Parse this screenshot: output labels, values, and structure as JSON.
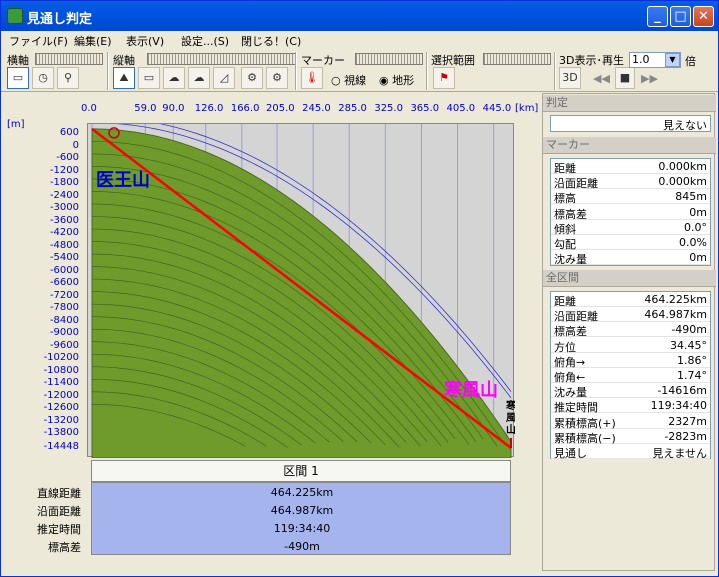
{
  "window": {
    "title": "見通し判定"
  },
  "menu": [
    "ファイル(F)",
    "編集(E)",
    "表示(V)",
    "設定...(S)",
    "閉じる！(C)"
  ],
  "toolbar": {
    "yoko_label": "横軸",
    "tate_label": "縦軸",
    "marker_label": "マーカー",
    "range_label": "選択範囲",
    "view3d_label": "3D表示･再生",
    "speed_value": "1.0",
    "speed_unit": "倍",
    "radio_shisen": "視線",
    "radio_chikei": "地形"
  },
  "chart_data": {
    "type": "line",
    "x_unit": "[km]",
    "y_unit": "[m]",
    "x_ticks": [
      "0.0",
      "59.0",
      "90.0",
      "126.0",
      "166.0",
      "205.0",
      "245.0",
      "285.0",
      "325.0",
      "365.0",
      "405.0",
      "445.0"
    ],
    "y_ticks": [
      "600",
      "0",
      "-600",
      "-1200",
      "-1800",
      "-2400",
      "-3000",
      "-3600",
      "-4200",
      "-4800",
      "-5400",
      "-6000",
      "-6600",
      "-7200",
      "-7800",
      "-8400",
      "-9000",
      "-9600",
      "-10200",
      "-10800",
      "-11400",
      "-12000",
      "-12600",
      "-13200",
      "-13800",
      "-14448"
    ],
    "ylim": [
      -14448,
      600
    ],
    "xlim": [
      0,
      464.225
    ],
    "start_label": "医王山",
    "end_label": "寒風山",
    "end_label_vertical": "寒風山",
    "sightline": {
      "from": [
        0,
        845
      ],
      "to": [
        464.225,
        -14448
      ]
    }
  },
  "section": {
    "header": "区間 1",
    "labels": [
      "直線距離",
      "沿面距離",
      "推定時間",
      "標高差"
    ],
    "values": [
      "464.225km",
      "464.987km",
      "119:34:40",
      "-490m"
    ]
  },
  "right_panel": {
    "hantei_title": "判定",
    "hantei_value": "見えない",
    "marker_title": "マーカー",
    "marker_rows": [
      {
        "k": "距離",
        "v": "0.000km"
      },
      {
        "k": "沿面距離",
        "v": "0.000km"
      },
      {
        "k": "標高",
        "v": "845m"
      },
      {
        "k": "標高差",
        "v": "0m"
      },
      {
        "k": "傾斜",
        "v": "0.0°"
      },
      {
        "k": "勾配",
        "v": "0.0%"
      },
      {
        "k": "沈み量",
        "v": "0m"
      }
    ],
    "all_title": "全区間",
    "all_rows": [
      {
        "k": "距離",
        "v": "464.225km"
      },
      {
        "k": "沿面距離",
        "v": "464.987km"
      },
      {
        "k": "標高差",
        "v": "-490m"
      },
      {
        "k": "方位",
        "v": "34.45°"
      },
      {
        "k": "俯角→",
        "v": "1.86°"
      },
      {
        "k": "俯角←",
        "v": "1.74°"
      },
      {
        "k": "沈み量",
        "v": "-14616m"
      },
      {
        "k": "推定時間",
        "v": "119:34:40"
      },
      {
        "k": "累積標高(+)",
        "v": "2327m"
      },
      {
        "k": "累積標高(−)",
        "v": "-2823m"
      },
      {
        "k": "見通し",
        "v": "見えません"
      }
    ]
  },
  "colors": {
    "terrain": "#6f9a2c",
    "sightline": "#ff0000",
    "start_label": "#0000cc",
    "end_label": "#ff00ff",
    "grid": "#3333cc"
  }
}
